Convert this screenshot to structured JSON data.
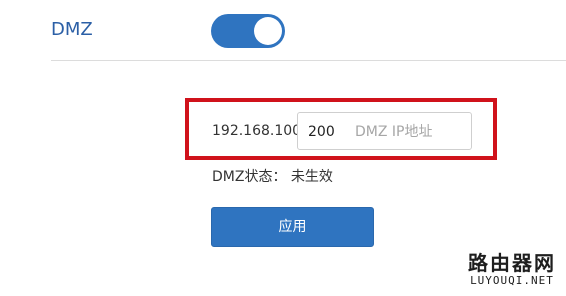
{
  "dmz": {
    "title": "DMZ",
    "enabled": true
  },
  "ip": {
    "prefix": "192.168.100.",
    "last_octet": "200",
    "placeholder": "DMZ IP地址"
  },
  "status": {
    "label": "DMZ状态：",
    "value": "未生效"
  },
  "apply_label": "应用",
  "watermark": {
    "cn": "路由器网",
    "en": "LUYOUQI.NET"
  },
  "colors": {
    "accent": "#2f74c0",
    "highlight": "#d0121b",
    "title": "#2b5fa6"
  }
}
